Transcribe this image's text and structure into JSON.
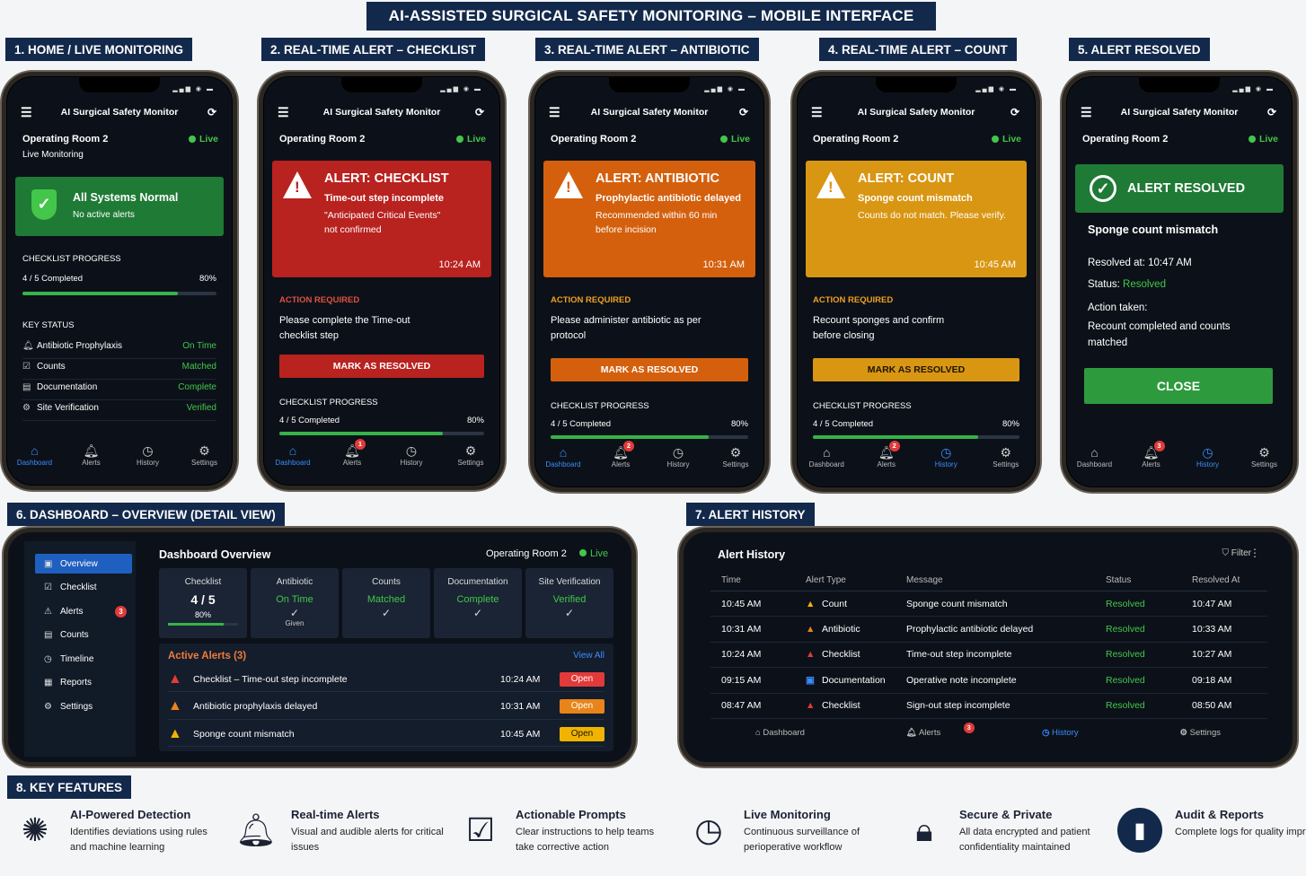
{
  "title": "AI-ASSISTED SURGICAL SAFETY MONITORING – MOBILE INTERFACE",
  "sections": {
    "s1": "1. HOME / LIVE MONITORING",
    "s2": "2. REAL-TIME ALERT – CHECKLIST",
    "s3": "3. REAL-TIME ALERT – ANTIBIOTIC",
    "s4": "4. REAL-TIME ALERT – COUNT",
    "s5": "5. ALERT RESOLVED",
    "s6": "6. DASHBOARD – OVERVIEW (DETAIL VIEW)",
    "s7": "7. ALERT HISTORY",
    "s8": "8. KEY FEATURES"
  },
  "app": {
    "name": "AI Surgical Safety Monitor",
    "room": "Operating Room 2",
    "live": "Live",
    "nav": [
      "Dashboard",
      "Alerts",
      "History",
      "Settings"
    ],
    "alerts_badge": "1",
    "alerts_badge2": "2",
    "alerts_badge3": "3"
  },
  "home": {
    "subtitle": "Live Monitoring",
    "status_title": "All Systems Normal",
    "status_sub": "No active alerts",
    "cp_label": "CHECKLIST PROGRESS",
    "cp_text": "4 / 5 Completed",
    "cp_pct": "80%",
    "key_label": "KEY STATUS",
    "key": [
      {
        "label": "Antibiotic Prophylaxis",
        "value": "On Time",
        "icon": "bell-icon"
      },
      {
        "label": "Counts",
        "value": "Matched",
        "icon": "check-square-icon"
      },
      {
        "label": "Documentation",
        "value": "Complete",
        "icon": "document-icon"
      },
      {
        "label": "Site Verification",
        "value": "Verified",
        "icon": "gear-icon"
      }
    ]
  },
  "checklist": {
    "title": "ALERT: CHECKLIST",
    "l1": "Time-out step incomplete",
    "l2": "\"Anticipated Critical Events\"",
    "l3": "not confirmed",
    "time": "10:24 AM",
    "action_label": "ACTION REQUIRED",
    "action": "Please complete the Time-out checklist step",
    "button": "MARK AS RESOLVED",
    "cp_label": "CHECKLIST PROGRESS",
    "cp_text": "4 / 5 Completed",
    "cp_pct": "80%",
    "color": "#b8221f"
  },
  "antibiotic": {
    "title": "ALERT: ANTIBIOTIC",
    "l1": "Prophylactic antibiotic delayed",
    "l2": "Recommended within 60 min before incision",
    "time": "10:31 AM",
    "action_label": "ACTION REQUIRED",
    "action": "Please administer antibiotic as per protocol",
    "button": "MARK AS RESOLVED",
    "cp_label": "CHECKLIST PROGRESS",
    "cp_text": "4 / 5 Completed",
    "cp_pct": "80%",
    "color": "#d4600e"
  },
  "count": {
    "title": "ALERT: COUNT",
    "l1": "Sponge count mismatch",
    "l2": "Counts do not match. Please verify.",
    "time": "10:45 AM",
    "action_label": "ACTION REQUIRED",
    "action": "Recount sponges and confirm before closing",
    "button": "MARK AS RESOLVED",
    "cp_label": "CHECKLIST PROGRESS",
    "cp_text": "4 / 5 Completed",
    "cp_pct": "80%",
    "color": "#d99613"
  },
  "resolved": {
    "title": "ALERT RESOLVED",
    "msg": "Sponge count mismatch",
    "at_label": "Resolved at:",
    "at": "10:47 AM",
    "status_label": "Status:",
    "status": "Resolved",
    "action_label": "Action taken:",
    "action": "Recount completed and counts matched",
    "button": "CLOSE"
  },
  "dashboard": {
    "title": "Dashboard Overview",
    "menu": [
      {
        "label": "Overview",
        "icon": "overview-icon"
      },
      {
        "label": "Checklist",
        "icon": "check-square-icon"
      },
      {
        "label": "Alerts",
        "icon": "alert-icon",
        "badge": "3"
      },
      {
        "label": "Counts",
        "icon": "counter-icon"
      },
      {
        "label": "Timeline",
        "icon": "timeline-icon"
      },
      {
        "label": "Reports",
        "icon": "report-icon"
      },
      {
        "label": "Settings",
        "icon": "gear-icon"
      }
    ],
    "cards": [
      {
        "label": "Checklist",
        "value": "4 / 5",
        "sub": "80%"
      },
      {
        "label": "Antibiotic",
        "value": "On Time",
        "sub": "Given"
      },
      {
        "label": "Counts",
        "value": "Matched",
        "sub": ""
      },
      {
        "label": "Documentation",
        "value": "Complete",
        "sub": ""
      },
      {
        "label": "Site Verification",
        "value": "Verified",
        "sub": ""
      }
    ],
    "active_title": "Active Alerts (3)",
    "view_all": "View All",
    "alerts": [
      {
        "text": "Checklist – Time-out step incomplete",
        "time": "10:24 AM",
        "status": "Open",
        "color": "#e23a3a"
      },
      {
        "text": "Antibiotic prophylaxis delayed",
        "time": "10:31 AM",
        "status": "Open",
        "color": "#e8841a"
      },
      {
        "text": "Sponge count mismatch",
        "time": "10:45 AM",
        "status": "Open",
        "color": "#f0b400"
      }
    ]
  },
  "history": {
    "title": "Alert History",
    "filter": "Filter",
    "cols": [
      "Time",
      "Alert Type",
      "Message",
      "Status",
      "Resolved At"
    ],
    "rows": [
      {
        "time": "10:45 AM",
        "type": "Count",
        "msg": "Sponge count mismatch",
        "status": "Resolved",
        "at": "10:47 AM",
        "color": "#f0b400"
      },
      {
        "time": "10:31 AM",
        "type": "Antibiotic",
        "msg": "Prophylactic antibiotic delayed",
        "status": "Resolved",
        "at": "10:33 AM",
        "color": "#e8841a"
      },
      {
        "time": "10:24 AM",
        "type": "Checklist",
        "msg": "Time-out step incomplete",
        "status": "Resolved",
        "at": "10:27 AM",
        "color": "#e23a3a"
      },
      {
        "time": "09:15 AM",
        "type": "Documentation",
        "msg": "Operative note incomplete",
        "status": "Resolved",
        "at": "09:18 AM",
        "color": "#3d8bfd"
      },
      {
        "time": "08:47 AM",
        "type": "Checklist",
        "msg": "Sign-out step incomplete",
        "status": "Resolved",
        "at": "08:50 AM",
        "color": "#e23a3a"
      }
    ],
    "nav": [
      "Dashboard",
      "Alerts",
      "History",
      "Settings"
    ],
    "badge": "3"
  },
  "features": [
    {
      "title": "AI-Powered Detection",
      "text": "Identifies deviations using rules and machine learning",
      "icon": "brain-icon"
    },
    {
      "title": "Real-time Alerts",
      "text": "Visual and audible alerts for critical issues",
      "icon": "bell-icon"
    },
    {
      "title": "Actionable Prompts",
      "text": "Clear instructions to help teams take corrective action",
      "icon": "clipboard-icon"
    },
    {
      "title": "Live Monitoring",
      "text": "Continuous surveillance of perioperative workflow",
      "icon": "clock-icon"
    },
    {
      "title": "Secure & Private",
      "text": "All data encrypted and patient confidentiality maintained",
      "icon": "lock-icon"
    },
    {
      "title": "Audit & Reports",
      "text": "Complete logs for quality improvement",
      "icon": "chart-icon"
    }
  ]
}
